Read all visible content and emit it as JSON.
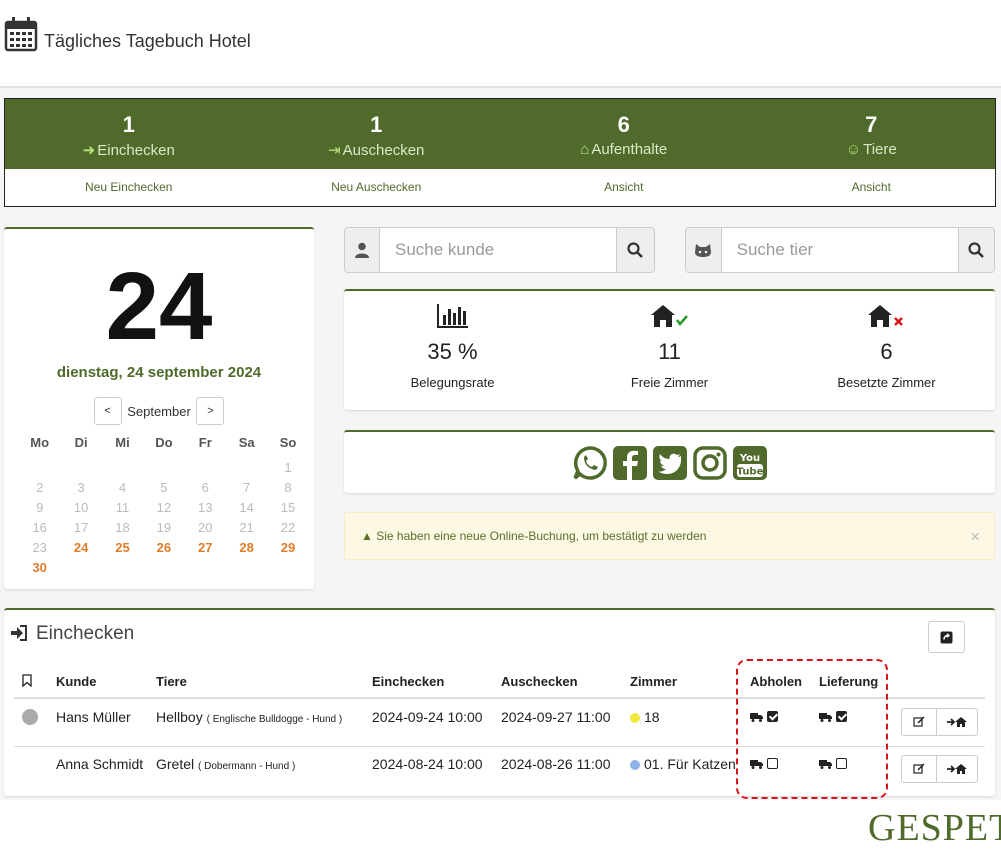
{
  "header": {
    "title": "Tägliches Tagebuch Hotel"
  },
  "stats": [
    {
      "count": "1",
      "label": "Einchecken",
      "link": "Neu Einchecken",
      "icon": "sign-in-icon"
    },
    {
      "count": "1",
      "label": "Auschecken",
      "link": "Neu Auschecken",
      "icon": "sign-out-icon"
    },
    {
      "count": "6",
      "label": "Aufenthalte",
      "link": "Ansicht",
      "icon": "home-icon"
    },
    {
      "count": "7",
      "label": "Tiere",
      "link": "Ansicht",
      "icon": "pet-icon"
    }
  ],
  "calendar": {
    "day": "24",
    "long_date": "dienstag, 24 september 2024",
    "month": "September",
    "prev": "<",
    "next": ">",
    "weekdays": [
      "Mo",
      "Di",
      "Mi",
      "Do",
      "Fr",
      "Sa",
      "So"
    ],
    "weeks": [
      [
        "",
        "",
        "",
        "",
        "",
        "",
        "1"
      ],
      [
        "2",
        "3",
        "4",
        "5",
        "6",
        "7",
        "8"
      ],
      [
        "9",
        "10",
        "11",
        "12",
        "13",
        "14",
        "15"
      ],
      [
        "16",
        "17",
        "18",
        "19",
        "20",
        "21",
        "22"
      ],
      [
        "23",
        "24",
        "25",
        "26",
        "27",
        "28",
        "29"
      ],
      [
        "30",
        "",
        "",
        "",
        "",
        "",
        ""
      ]
    ],
    "highlighted": [
      "24",
      "25",
      "26",
      "27",
      "28",
      "29",
      "30"
    ]
  },
  "search": {
    "customer_placeholder": "Suche kunde",
    "pet_placeholder": "Suche tier"
  },
  "occupancy": [
    {
      "value": "35 %",
      "label": "Belegungsrate",
      "icon": "bar-chart-icon"
    },
    {
      "value": "11",
      "label": "Freie Zimmer",
      "icon": "home-check-icon"
    },
    {
      "value": "6",
      "label": "Besetzte Zimmer",
      "icon": "home-x-icon"
    }
  ],
  "social": [
    "whatsapp-icon",
    "facebook-icon",
    "twitter-icon",
    "instagram-icon",
    "youtube-icon"
  ],
  "alert": {
    "text": "Sie haben eine neue Online-Buchung, um bestätigt zu werden",
    "close": "×"
  },
  "checkin_table": {
    "title": "Einchecken",
    "columns": [
      "Kunde",
      "Tiere",
      "Einchecken",
      "Auschecken",
      "Zimmer",
      "Abholen",
      "Lieferung"
    ],
    "rows": [
      {
        "customer": "Hans Müller",
        "pet": "Hellboy",
        "pet_detail": "( Englische Bulldogge - Hund )",
        "checkin": "2024-09-24 10:00",
        "checkout": "2024-09-27 11:00",
        "room": "18",
        "room_color": "#f2e93a",
        "pickup": true,
        "delivery": true,
        "status": "gray"
      },
      {
        "customer": "Anna Schmidt",
        "pet": "Gretel",
        "pet_detail": "( Dobermann - Hund )",
        "checkin": "2024-08-24 10:00",
        "checkout": "2024-08-26 11:00",
        "room": "01. Für Katzen",
        "room_color": "#8fb3e6",
        "pickup": false,
        "delivery": false,
        "status": "none"
      }
    ]
  },
  "brand": {
    "accent": "#4f6a2a",
    "highlight": "#e07c2a",
    "logo": "GESPET"
  }
}
